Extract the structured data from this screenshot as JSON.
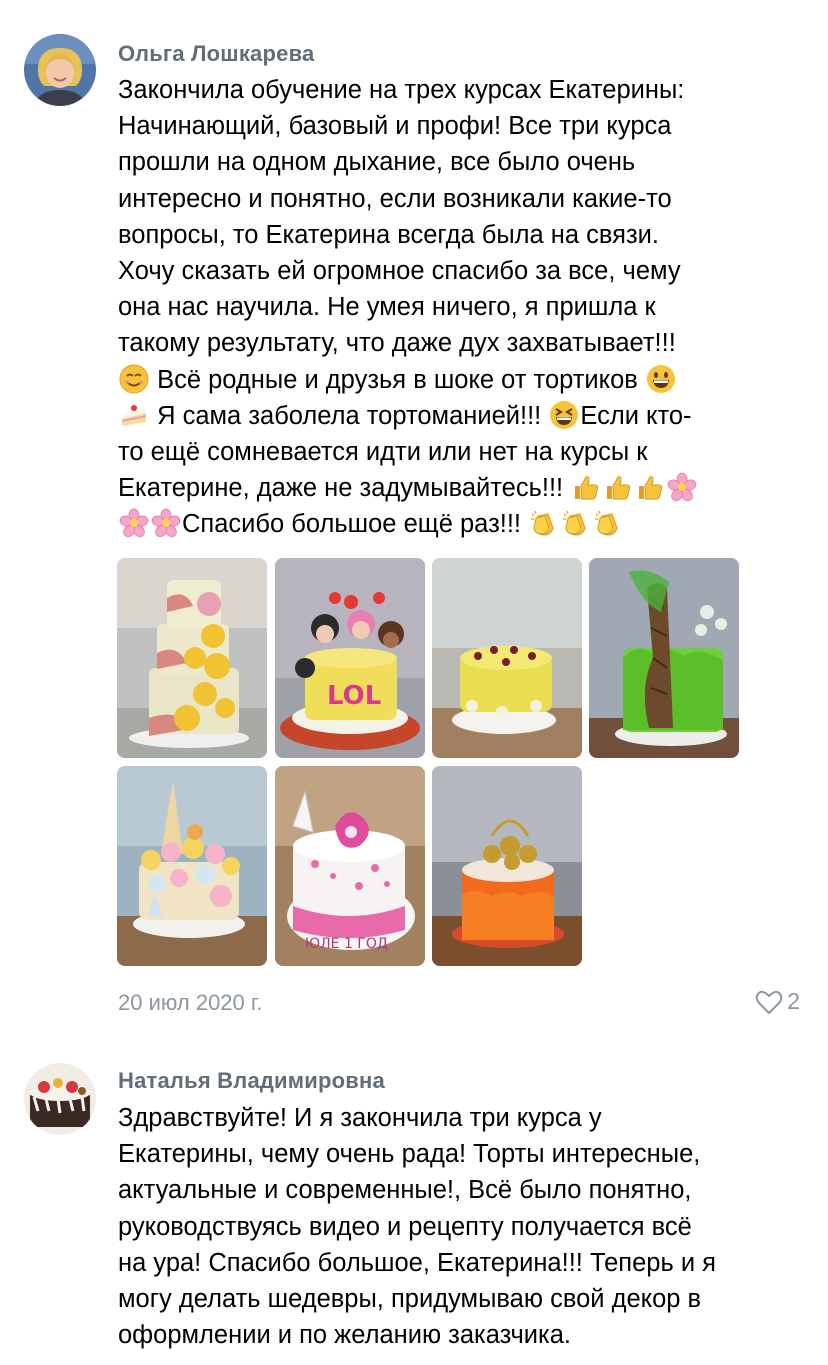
{
  "comments": [
    {
      "author": "Ольга Лошкарева",
      "lines": [
        "Закончила обучение на трех курсах Екатерины:",
        "Начинающий, базовый и профи! Все три курса",
        "прошли на одном дыхание, все было очень",
        "интересно и понятно, если возникали какие-то",
        "вопросы, то Екатерина всегда была на связи.",
        "Хочу сказать ей огромное спасибо за все, чему",
        "она нас научила. Не умея ничего, я пришла к",
        "такому результату, что даже дух захватывает!!!"
      ],
      "emoji_lines": {
        "l9": " Всё родные и друзья в шоке от тортиков ",
        "l10a": " Я сама заболела тортоманией!!! ",
        "l10b": "Если кто-",
        "l11": "то ещё сомневается идти или нет на курсы к",
        "l12": "Екатерине, даже не задумывайтесь!!! ",
        "l13": "Спасибо большое ещё раз!!! "
      },
      "emojis": {
        "smile": "smiling-face-emoji",
        "grin": "grinning-face-emoji",
        "cake": "shortcake-emoji",
        "laugh": "laughing-face-emoji",
        "thumb": "thumbs-up-emoji",
        "flower": "cherry-blossom-emoji",
        "clap": "clapping-hands-emoji"
      },
      "photos": [
        "tiered-wedding-cake-yellow-flowers",
        "lol-surprise-doll-cake",
        "yellow-cake-with-berries",
        "green-moss-forest-cake",
        "pastel-unicorn-flower-cake",
        "pink-birthday-cake",
        "orange-cake-with-gold-spheres"
      ],
      "date": "20 июл 2020 г.",
      "likes": "2"
    },
    {
      "author": "Наталья Владимировна",
      "lines": [
        "Здравствуйте! И я закончила три курса у",
        "Екатерины, чему очень рада! Торты интересные,",
        "актуальные и современные!, Всё было понятно,",
        "руководствуясь видео и рецепту получается всё",
        "на ура! Спасибо большое, Екатерина!!! Теперь и я",
        "могу делать шедевры, придумываю свой декор в",
        "оформлении и по желанию заказчика."
      ]
    }
  ],
  "colors": {
    "author": "#626d7a",
    "meta": "#8d96a1",
    "text": "#000000"
  }
}
